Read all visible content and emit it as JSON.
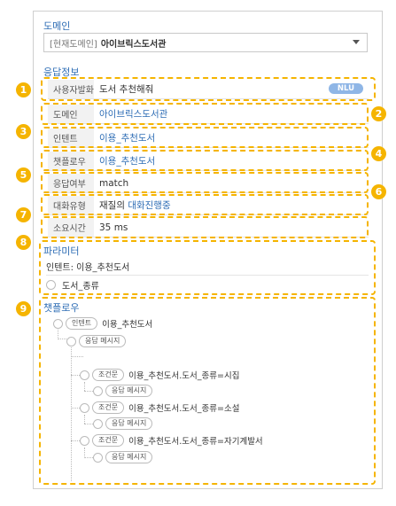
{
  "domain_section": {
    "title": "도메인",
    "current_label": "[현재도메인]",
    "current_value": "아이브릭스도서관"
  },
  "response_info": {
    "title": "응답정보",
    "rows": [
      {
        "num": "1",
        "key": "사용자발화",
        "value": "도서 추천해줘",
        "badge": "NLU"
      },
      {
        "num": "2",
        "key": "도메인",
        "value": "아이브릭스도서관"
      },
      {
        "num": "3",
        "key": "인텐트",
        "value": "이용_추천도서"
      },
      {
        "num": "4",
        "key": "챗플로우",
        "value": "이용_추천도서"
      },
      {
        "num": "5",
        "key": "응답여부",
        "value": "match"
      },
      {
        "num": "6",
        "key": "대화유형",
        "value_prefix": "재질의",
        "value_suffix": "대화진행중"
      },
      {
        "num": "7",
        "key": "소요시간",
        "value": "35 ms"
      }
    ]
  },
  "parameter": {
    "num": "8",
    "title": "파라미터",
    "intent_line": "인텐트: 이용_추천도서",
    "param": "도서_종류"
  },
  "chatflow": {
    "num": "9",
    "title": "챗플로우",
    "nodes": [
      {
        "tag": "인텐트",
        "text": "이용_추천도서"
      },
      {
        "tag": "응답 메시지",
        "text": ""
      },
      {
        "tag": "조건문",
        "text": "이용_추천도서.도서_종류=시집"
      },
      {
        "tag": "응답 메시지",
        "text": ""
      },
      {
        "tag": "조건문",
        "text": "이용_추천도서.도서_종류=소설"
      },
      {
        "tag": "응답 메시지",
        "text": ""
      },
      {
        "tag": "조건문",
        "text": "이용_추천도서.도서_종류=자기계발서"
      },
      {
        "tag": "응답 메시지",
        "text": ""
      }
    ]
  },
  "colors": {
    "accent": "#f5b400",
    "link": "#2e6db5",
    "badge": "#8fb6e6"
  }
}
